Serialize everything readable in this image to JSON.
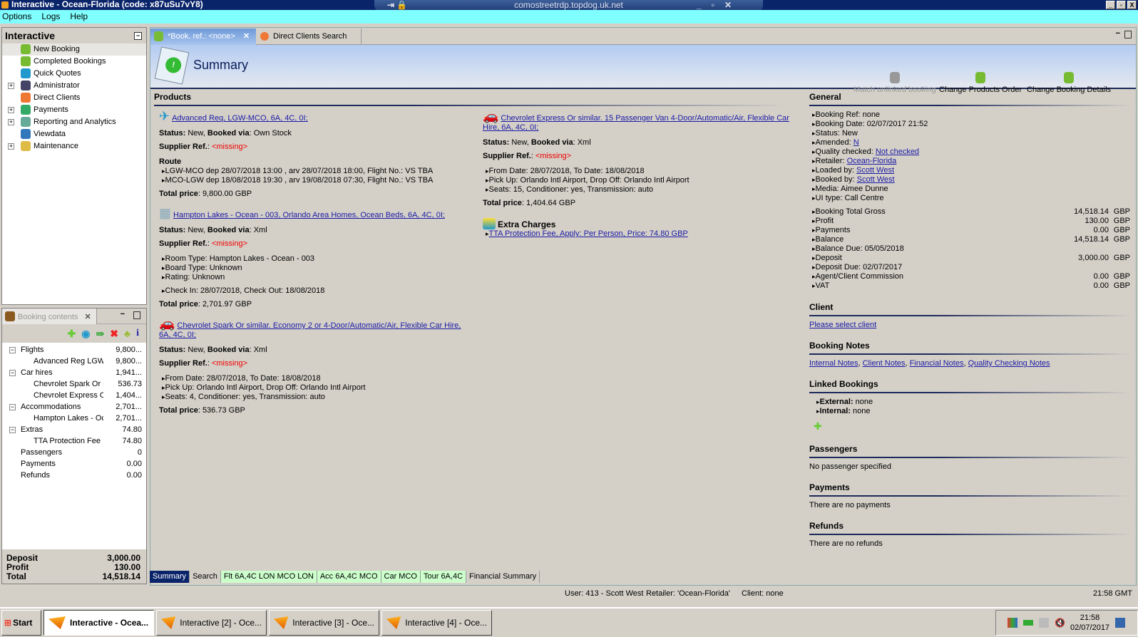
{
  "window": {
    "title": "Interactive - Ocean-Florida (code: x87uSu7vY8)",
    "rdp_host": "comostreetrdp.topdog.uk.net"
  },
  "menu": [
    "Options",
    "Logs",
    "Help"
  ],
  "nav": {
    "title": "Interactive",
    "items": [
      {
        "label": "New Booking",
        "expandable": false,
        "selected": true,
        "icon": "palm-tree-icon"
      },
      {
        "label": "Completed Bookings",
        "expandable": false,
        "icon": "palm-tree-icon"
      },
      {
        "label": "Quick Quotes",
        "expandable": false,
        "icon": "clock-icon"
      },
      {
        "label": "Administrator",
        "expandable": true,
        "icon": "person-icon"
      },
      {
        "label": "Direct Clients",
        "expandable": false,
        "icon": "clients-icon"
      },
      {
        "label": "Payments",
        "expandable": true,
        "icon": "payments-icon"
      },
      {
        "label": "Reporting and Analytics",
        "expandable": true,
        "icon": "report-icon"
      },
      {
        "label": "Viewdata",
        "expandable": false,
        "icon": "globe-icon"
      },
      {
        "label": "Maintenance",
        "expandable": true,
        "icon": "maintenance-icon"
      }
    ]
  },
  "booking_contents": {
    "title": "Booking contents",
    "rows": [
      {
        "name": "Flights",
        "value": "9,800...",
        "level": 0,
        "group": true
      },
      {
        "name": "Advanced Reg LGW>M",
        "value": "9,800...",
        "level": 1
      },
      {
        "name": "Car hires",
        "value": "1,941...",
        "level": 0,
        "group": true
      },
      {
        "name": "Chevrolet Spark Or sin",
        "value": "536.73",
        "level": 1
      },
      {
        "name": "Chevrolet Express Or",
        "value": "1,404...",
        "level": 1
      },
      {
        "name": "Accommodations",
        "value": "2,701...",
        "level": 0,
        "group": true
      },
      {
        "name": "Hampton Lakes - Ocea",
        "value": "2,701...",
        "level": 1
      },
      {
        "name": "Extras",
        "value": "74.80",
        "level": 0,
        "group": true
      },
      {
        "name": "TTA Protection Fee",
        "value": "74.80",
        "level": 1
      },
      {
        "name": "Passengers",
        "value": "0",
        "level": 0
      },
      {
        "name": "Payments",
        "value": "0.00",
        "level": 0
      },
      {
        "name": "Refunds",
        "value": "0.00",
        "level": 0
      }
    ],
    "totals": [
      {
        "label": "Deposit",
        "value": "3,000.00"
      },
      {
        "label": "Profit",
        "value": "130.00"
      },
      {
        "label": "Total",
        "value": "14,518.14"
      }
    ]
  },
  "tabs": [
    {
      "label": "*Book. ref.: <none>",
      "active": true
    },
    {
      "label": "Direct Clients Search"
    }
  ],
  "summary": {
    "title": "Summary",
    "actions": [
      {
        "label": "Match unlinked booking",
        "disabled": true
      },
      {
        "label": "Change Products Order"
      },
      {
        "label": "Change Booking Details"
      }
    ]
  },
  "labels": {
    "products": "Products",
    "status": "Status:",
    "booked_via": "Booked via",
    "supplier_ref": "Supplier Ref.",
    "total_price": "Total price",
    "route": "Route",
    "missing": "<missing>"
  },
  "products_left": [
    {
      "icon": "airplane-icon",
      "link": "Advanced Req, LGW-MCO, 6A, 4C, 0I;",
      "status": "New",
      "booked_via": "Own Stock",
      "route": true,
      "lines": [
        "LGW-MCO dep 28/07/2018 13:00 , arv 28/07/2018 18:00, Flight No.: VS TBA",
        "MCO-LGW dep 18/08/2018 19:30 , arv 19/08/2018 07:30, Flight No.: VS TBA"
      ],
      "total": "9,800.00 GBP"
    },
    {
      "icon": "building-icon",
      "link": "Hampton Lakes - Ocean - 003, Orlando Area Homes, Ocean Beds, 6A, 4C, 0I;",
      "status": "New",
      "booked_via": "Xml",
      "lines": [
        "Room Type: Hampton Lakes - Ocean - 003",
        "Board Type: Unknown",
        "Rating: Unknown"
      ],
      "lines2": [
        "Check In: 28/07/2018, Check Out: 18/08/2018"
      ],
      "total": "2,701.97 GBP"
    },
    {
      "icon": "car-icon",
      "link": "Chevrolet Spark Or similar. Economy 2 or 4-Door/Automatic/Air, Flexible Car Hire, 6A, 4C, 0I;",
      "status": "New",
      "booked_via": "Xml",
      "lines": [
        "From Date: 28/07/2018, To Date: 18/08/2018",
        "Pick Up: Orlando Intl Airport, Drop Off: Orlando Intl Airport",
        "Seats: 4, Conditioner: yes, Transmission: auto"
      ],
      "total": "536.73 GBP"
    }
  ],
  "products_right": [
    {
      "icon": "car-icon",
      "link": "Chevrolet Express Or similar. 15 Passenger Van 4-Door/Automatic/Air, Flexible Car Hire, 6A, 4C, 0I;",
      "status": "New",
      "booked_via": "Xml",
      "lines": [
        "From Date: 28/07/2018, To Date: 18/08/2018",
        "Pick Up: Orlando Intl Airport, Drop Off: Orlando Intl Airport",
        "Seats: 15, Conditioner: yes, Transmission: auto"
      ],
      "total": "1,404.64 GBP"
    }
  ],
  "extras": {
    "title": "Extra Charges",
    "items": [
      "TTA Protection Fee, Apply: Per Person, Price: 74.80 GBP"
    ]
  },
  "general": {
    "title": "General",
    "info": [
      {
        "label": "Booking Ref: ",
        "value": "none"
      },
      {
        "label": "Booking Date: ",
        "value": "02/07/2017 21:52"
      },
      {
        "label": "Status: ",
        "value": "New"
      },
      {
        "label": "Amended: ",
        "link": "N"
      },
      {
        "label": "Quality checked: ",
        "link": "Not checked"
      },
      {
        "label": "Retailer: ",
        "link": "Ocean-Florida"
      },
      {
        "label": "Loaded by: ",
        "link": "Scott West"
      },
      {
        "label": "Booked by: ",
        "link": "Scott West"
      },
      {
        "label": "Media: ",
        "value": "Aimee Dunne"
      },
      {
        "label": "UI type: ",
        "value": "Call Centre"
      }
    ],
    "money": [
      {
        "label": "Booking Total Gross",
        "amount": "14,518.14",
        "cur": "GBP"
      },
      {
        "label": "Profit",
        "amount": "130.00",
        "cur": "GBP"
      },
      {
        "label": "Payments",
        "amount": "0.00",
        "cur": "GBP"
      },
      {
        "label": "Balance",
        "amount": "14,518.14",
        "cur": "GBP"
      },
      {
        "label": "Balance Due: 05/05/2018"
      },
      {
        "label": "Deposit",
        "amount": "3,000.00",
        "cur": "GBP"
      },
      {
        "label": "Deposit Due: 02/07/2017"
      },
      {
        "label": "Agent/Client Commission",
        "amount": "0.00",
        "cur": "GBP"
      },
      {
        "label": "VAT",
        "amount": "0.00",
        "cur": "GBP"
      }
    ]
  },
  "client": {
    "title": "Client",
    "link": "Please select client"
  },
  "notes": {
    "title": "Booking Notes",
    "links": [
      "Internal Notes",
      "Client Notes",
      "Financial Notes",
      "Quality Checking Notes"
    ]
  },
  "linked": {
    "title": "Linked Bookings",
    "external_label": "External:",
    "external": "none",
    "internal_label": "Internal:",
    "internal": "none"
  },
  "passengers": {
    "title": "Passengers",
    "text": "No passenger specified"
  },
  "payments": {
    "title": "Payments",
    "text": "There are no payments"
  },
  "refunds": {
    "title": "Refunds",
    "text": "There are no refunds"
  },
  "bottom_tabs": [
    {
      "label": "Summary",
      "style": "active"
    },
    {
      "label": "Search"
    },
    {
      "label": "Flt 6A,4C LON MCO LON",
      "style": "green"
    },
    {
      "label": "Acc 6A,4C MCO",
      "style": "green"
    },
    {
      "label": "Car MCO",
      "style": "green"
    },
    {
      "label": "Tour 6A,4C",
      "style": "green"
    },
    {
      "label": "Financial Summary"
    }
  ],
  "status": {
    "user": "User: 413 - Scott West",
    "retailer": "Retailer: 'Ocean-Florida'",
    "client": "Client: none",
    "time": "21:58 GMT"
  },
  "taskbar": {
    "start": "Start",
    "items": [
      {
        "label": "Interactive - Ocea...",
        "active": true
      },
      {
        "label": "Interactive [2] - Oce..."
      },
      {
        "label": "Interactive [3] - Oce..."
      },
      {
        "label": "Interactive [4] - Oce..."
      }
    ],
    "clock_time": "21:58",
    "clock_date": "02/07/2017"
  },
  "colors": {
    "title_bar": "#0a246a",
    "menu_bar": "#80ffff",
    "link": "#1a1aa6",
    "missing": "#e00000",
    "active_tab": "#0a246a",
    "green_tab": "#ccffcc"
  }
}
